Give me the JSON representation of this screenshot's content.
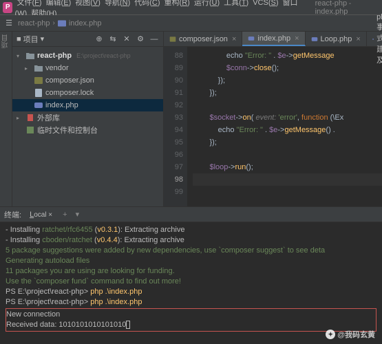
{
  "menu": {
    "items": [
      "文件(F)",
      "编辑(E)",
      "视图(V)",
      "导航(N)",
      "代码(C)",
      "重构(R)",
      "运行(U)",
      "工具(T)",
      "VCS(S)",
      "窗口(W)",
      "帮助(H)"
    ],
    "crumb": [
      "react-php",
      "index.php"
    ]
  },
  "toolbar": {
    "crumb_project": "react-php",
    "crumb_file": "index.php"
  },
  "sidebar": {
    "title": "项目",
    "tree": [
      {
        "d": 0,
        "arr": "▾",
        "ic": "folder",
        "lbl": "react-php",
        "bold": true,
        "hint": "E:\\project\\react-php"
      },
      {
        "d": 1,
        "arr": "▸",
        "ic": "folder",
        "lbl": "vendor"
      },
      {
        "d": 1,
        "arr": "",
        "ic": "json",
        "lbl": "composer.json"
      },
      {
        "d": 1,
        "arr": "",
        "ic": "file",
        "lbl": "composer.lock"
      },
      {
        "d": 1,
        "arr": "",
        "ic": "php",
        "lbl": "index.php",
        "sel": true
      },
      {
        "d": 0,
        "arr": "▸",
        "ic": "lib",
        "lbl": "外部库"
      },
      {
        "d": 0,
        "arr": "",
        "ic": "scratch",
        "lbl": "临时文件和控制台"
      }
    ]
  },
  "tabs": [
    {
      "label": "composer.json",
      "ic": "json"
    },
    {
      "label": "index.php",
      "ic": "php",
      "active": true
    },
    {
      "label": "Loop.php",
      "ic": "php"
    },
    {
      "label": "php事件式搭建tcp及we",
      "ic": "php"
    }
  ],
  "code": {
    "start": 88,
    "cur": 98,
    "lines": [
      "                echo <span class=s>\"Error: \"</span> . <span class=v>$e</span>-><span class=m>getMessage</span>",
      "                <span class=v>$conn</span>-><span class=m>close</span>();",
      "            });",
      "        });",
      "",
      "        <span class=v>$socket</span>-><span class=m>on</span>( <span class=p>event:</span> <span class=s>'error'</span>, <span class=k>function</span> (\\Ex",
      "            echo <span class=s>\"Error: \"</span> . <span class=v>$e</span>-><span class=m>getMessage</span>() .",
      "        });",
      "",
      "        <span class=v>$loop</span>-><span class=m>run</span>();",
      "",
      ""
    ]
  },
  "terminal": {
    "title": "终端:",
    "tab": "Local",
    "lines": [
      {
        "cls": "w",
        "t": "  - Installing <span class=g>ratchet/rfc6455</span> (<span class=y>v0.3.1</span>): Extracting archive"
      },
      {
        "cls": "w",
        "t": "  - Installing <span class=g>cboden/ratchet</span> (<span class=y>v0.4.4</span>): Extracting archive"
      },
      {
        "cls": "g",
        "t": "5 package suggestions were added by new dependencies, use `composer suggest` to see deta"
      },
      {
        "cls": "g",
        "t": "Generating autoload files"
      },
      {
        "cls": "g",
        "t": "11 packages you are using are looking for funding."
      },
      {
        "cls": "g",
        "t": "Use the `composer fund` command to find out more!"
      },
      {
        "cls": "w",
        "t": "PS E:\\project\\react-php> <span class=y>php .\\index.php</span>"
      },
      {
        "cls": "w",
        "t": "PS E:\\project\\react-php> <span class=y>php .\\index.php</span>"
      },
      {
        "cls": "w",
        "t": "New connection",
        "hl": 1
      },
      {
        "cls": "w",
        "t": "Received data: 1010101010101010<span class=cursor></span>",
        "hl": 2
      }
    ]
  },
  "watermark": "@我码玄黄"
}
